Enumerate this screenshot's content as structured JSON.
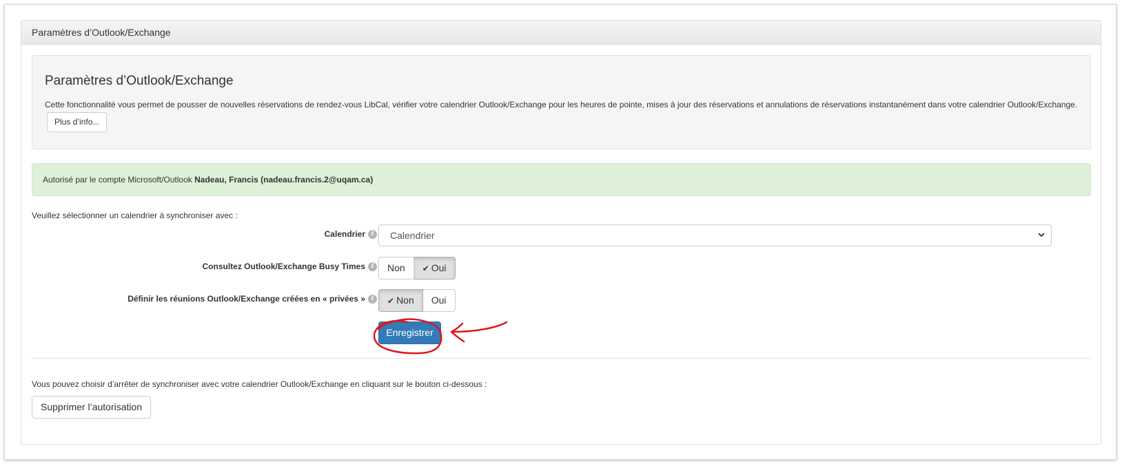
{
  "panel": {
    "heading": "Paramètres d’Outlook/Exchange"
  },
  "well": {
    "title": "Paramètres d’Outlook/Exchange",
    "description": "Cette fonctionnalité vous permet de pousser de nouvelles réservations de rendez-vous LibCal, vérifier votre calendrier Outlook/Exchange pour les heures de pointe, mises à jour des réservations et annulations de réservations instantanément dans votre calendrier Outlook/Exchange.",
    "more_info_label": "Plus d’info..."
  },
  "alert": {
    "prefix": "Autorisé par le compte Microsoft/Outlook",
    "account": "Nadeau, Francis (nadeau.francis.2@uqam.ca)"
  },
  "form": {
    "prompt": "Veuillez sélectionner un calendrier à synchroniser avec :",
    "calendar": {
      "label": "Calendrier",
      "value": "Calendrier"
    },
    "busy_times": {
      "label": "Consultez Outlook/Exchange Busy Times",
      "options": [
        "Non",
        "Oui"
      ],
      "selected": "Oui"
    },
    "private_meetings": {
      "label": "Définir les réunions Outlook/Exchange créées en « privées »",
      "options": [
        "Non",
        "Oui"
      ],
      "selected": "Non"
    },
    "save_label": "Enregistrer"
  },
  "stop_sync": {
    "text": "Vous pouvez choisir d’arrêter de synchroniser avec votre calendrier Outlook/Exchange en cliquant sur le bouton ci-dessous :",
    "button_label": "Supprimer l’autorisation"
  },
  "icons": {
    "info": "info-icon",
    "check": "check-icon",
    "chevron": "chevron-down-icon"
  },
  "colors": {
    "primary": "#337ab7",
    "success_bg": "#dff0d8",
    "annotation": "#e0161b"
  }
}
